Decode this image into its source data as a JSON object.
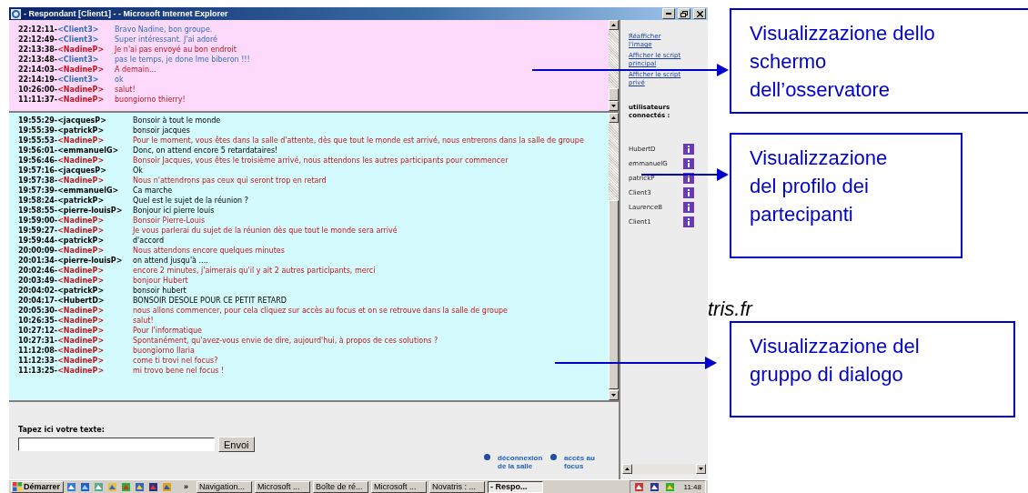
{
  "window": {
    "title": "- Respondant [Client1] - - Microsoft Internet Explorer"
  },
  "observer_log": {
    "messages": [
      {
        "time": "22:12:11-",
        "speaker": "<Client3>",
        "text": "Bravo Nadine, bon groupe.",
        "kind": "client"
      },
      {
        "time": "22:12:49-",
        "speaker": "<Client3>",
        "text": "Super intéressant. J'ai adoré",
        "kind": "client"
      },
      {
        "time": "22:13:38-",
        "speaker": "<NadineP>",
        "text": "Je n'ai pas envoyé au bon endroit",
        "kind": "moderator"
      },
      {
        "time": "22:13:48-",
        "speaker": "<Client3>",
        "text": "pas le temps, je done lme biberon !!!",
        "kind": "client"
      },
      {
        "time": "22:14:03-",
        "speaker": "<NadineP>",
        "text": "A demain...",
        "kind": "moderator"
      },
      {
        "time": "22:14:19-",
        "speaker": "<Client3>",
        "text": "ok",
        "kind": "client"
      },
      {
        "time": "10:26:00-",
        "speaker": "<NadineP>",
        "text": "salut!",
        "kind": "moderator"
      },
      {
        "time": "11:11:37-",
        "speaker": "<NadineP>",
        "text": "buongiorno thierry!",
        "kind": "moderator"
      }
    ]
  },
  "group_chat": {
    "messages": [
      {
        "time": "19:55:29-",
        "speaker": "<jacquesP>",
        "text": "Bonsoir à tout le monde",
        "kind": "participant"
      },
      {
        "time": "19:55:39-",
        "speaker": "<patrickP>",
        "text": "bonsoir jacques",
        "kind": "participant"
      },
      {
        "time": "19:55:53-",
        "speaker": "<NadineP>",
        "text": "Pour le moment, vous êtes dans la salle d'attente, dès que tout le monde est arrivé, nous entrerons dans la salle de groupe",
        "kind": "moderator"
      },
      {
        "time": "19:56:01-",
        "speaker": "<emmanuelG>",
        "text": "Donc, on attend encore 5 retardataires!",
        "kind": "participant"
      },
      {
        "time": "19:56:46-",
        "speaker": "<NadineP>",
        "text": "Bonsoir Jacques, vous êtes le troisième arrivé, nous attendons les autres participants pour commencer",
        "kind": "moderator"
      },
      {
        "time": "19:57:16-",
        "speaker": "<jacquesP>",
        "text": "Ok",
        "kind": "participant"
      },
      {
        "time": "19:57:38-",
        "speaker": "<NadineP>",
        "text": "Nous n'attendrons pas ceux qui seront trop en retard",
        "kind": "moderator"
      },
      {
        "time": "19:57:39-",
        "speaker": "<emmanuelG>",
        "text": "Ca marche",
        "kind": "participant"
      },
      {
        "time": "19:58:24-",
        "speaker": "<patrickP>",
        "text": "Quel est le sujet de la réunion ?",
        "kind": "participant"
      },
      {
        "time": "19:58:55-",
        "speaker": "<pierre-louisP>",
        "text": "Bonjour ici pierre louis",
        "kind": "participant"
      },
      {
        "time": "19:59:00-",
        "speaker": "<NadineP>",
        "text": "Bonsoir Pierre-Louis",
        "kind": "moderator"
      },
      {
        "time": "19:59:27-",
        "speaker": "<NadineP>",
        "text": "Je vous parlerai du sujet de la réunion dès que tout le monde sera arrivé",
        "kind": "moderator"
      },
      {
        "time": "19:59:44-",
        "speaker": "<patrickP>",
        "text": "d'accord",
        "kind": "participant"
      },
      {
        "time": "20:00:09-",
        "speaker": "<NadineP>",
        "text": "Nous attendons encore quelques minutes",
        "kind": "moderator"
      },
      {
        "time": "20:01:34-",
        "speaker": "<pierre-louisP>",
        "text": "on attend jusqu'à ....",
        "kind": "participant"
      },
      {
        "time": "20:02:46-",
        "speaker": "<NadineP>",
        "text": "encore 2 minutes, j'aimerais qu'il y ait 2 autres participants, merci",
        "kind": "moderator"
      },
      {
        "time": "20:03:49-",
        "speaker": "<NadineP>",
        "text": "bonjour Hubert",
        "kind": "moderator"
      },
      {
        "time": "20:04:02-",
        "speaker": "<patrickP>",
        "text": "bonsoir hubert",
        "kind": "participant"
      },
      {
        "time": "20:04:17-",
        "speaker": "<HubertD>",
        "text": "BONSOIR DESOLE POUR CE PETIT RETARD",
        "kind": "participant"
      },
      {
        "time": "20:05:30-",
        "speaker": "<NadineP>",
        "text": "nous allons commencer, pour cela cliquez sur accès au focus et on se retrouve dans la salle de groupe",
        "kind": "moderator"
      },
      {
        "time": "10:26:35-",
        "speaker": "<NadineP>",
        "text": "salut!",
        "kind": "moderator"
      },
      {
        "time": "10:27:12-",
        "speaker": "<NadineP>",
        "text": "Pour l'informatique",
        "kind": "moderator"
      },
      {
        "time": "10:27:31-",
        "speaker": "<NadineP>",
        "text": "Spontanément, qu'avez-vous envie de dire, aujourd'hui, à propos de ces solutions ?",
        "kind": "moderator"
      },
      {
        "time": "11:12:08-",
        "speaker": "<NadineP>",
        "text": "buongiorno Ilaria",
        "kind": "moderator"
      },
      {
        "time": "11:12:33-",
        "speaker": "<NadineP>",
        "text": "come ti trovi nel focus?",
        "kind": "moderator"
      },
      {
        "time": "11:13:25-",
        "speaker": "<NadineP>",
        "text": "mi trovo bene nel focus !",
        "kind": "moderator"
      }
    ]
  },
  "compose": {
    "label": "Tapez ici votre texte:",
    "button": "Envoi"
  },
  "room_links": [
    {
      "label": "déconnexion de la salle"
    },
    {
      "label": "accés au focus"
    }
  ],
  "sidebar": {
    "links": [
      "Réafficher l'image",
      "Afficher le script principal",
      "Afficher le script privé"
    ],
    "users_heading": "utilisateurs connectés :",
    "users": [
      "HubertD",
      "emmanuelG",
      "patrickP",
      "Client3",
      "LaurenceB",
      "Client1"
    ]
  },
  "taskbar": {
    "start": "Démarrer",
    "more": "»",
    "tasks": [
      {
        "label": "Navigation...",
        "selected": false
      },
      {
        "label": "Microsoft ...",
        "selected": false
      },
      {
        "label": "Boîte de ré...",
        "selected": false
      },
      {
        "label": "Microsoft ...",
        "selected": false
      },
      {
        "label": "Novatris : ...",
        "selected": false
      },
      {
        "label": "- Respo...",
        "selected": true
      }
    ],
    "clock": "11:48"
  },
  "slide_text": "tris.fr",
  "callouts": [
    {
      "lines": [
        "Visualizzazione dello",
        "schermo",
        "dell’osservatore"
      ]
    },
    {
      "lines": [
        "Visualizzazione",
        "del profilo dei",
        "partecipanti"
      ]
    },
    {
      "lines": [
        "Visualizzazione del",
        "gruppo di dialogo"
      ]
    }
  ]
}
